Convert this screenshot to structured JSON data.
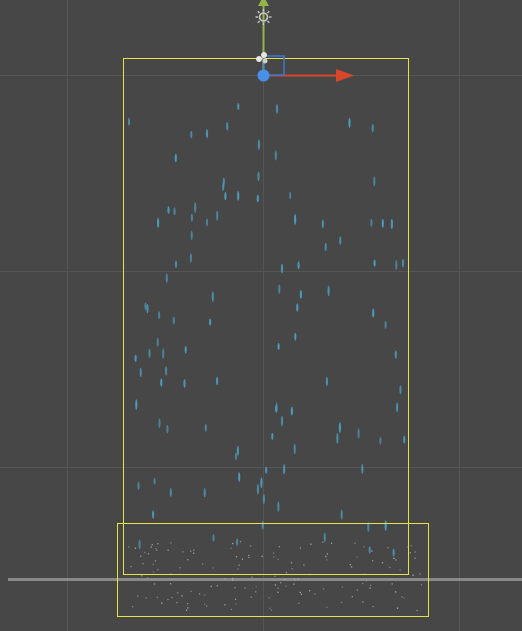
{
  "scene_view": {
    "background": "#474747",
    "grid_color": "#555555",
    "horizon_color": "#8a8a8a"
  },
  "gizmos": {
    "emitter_bounds_color": "#e6e24a",
    "collision_bounds_color": "#e6e24a",
    "x_axis_color": "#d8472b",
    "y_axis_color": "#94b54a",
    "z_axis_color": "#3b78d4",
    "pivot_color": "#4a8fe7",
    "light_icon": "sun-icon",
    "particle_icon": "particle-system-icon"
  },
  "particles": {
    "rain_color": "#4d9cbc",
    "splash_color": "#b7b7b7",
    "rain_drop_count": 110,
    "splash_count": 150
  }
}
